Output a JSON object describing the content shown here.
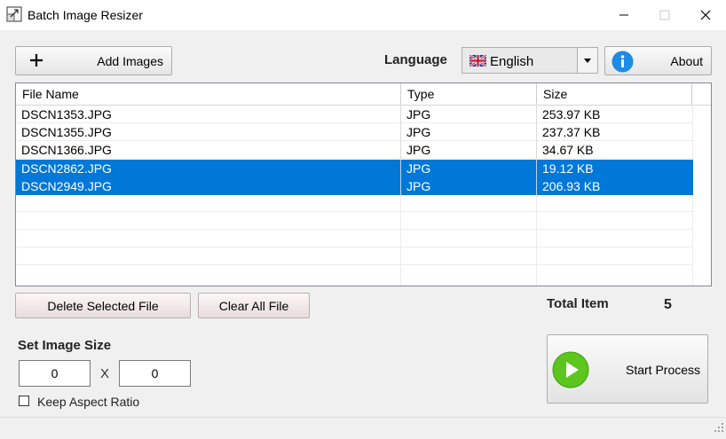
{
  "window": {
    "title": "Batch Image Resizer",
    "accent": "#0078d7"
  },
  "toolbar": {
    "add_images_label": "Add Images",
    "language_label": "Language",
    "language_value": "English",
    "about_label": "About"
  },
  "file_list": {
    "columns": [
      "File Name",
      "Type",
      "Size"
    ],
    "rows": [
      {
        "name": "DSCN1353.JPG",
        "type": "JPG",
        "size": "253.97 KB",
        "selected": false
      },
      {
        "name": "DSCN1355.JPG",
        "type": "JPG",
        "size": "237.37 KB",
        "selected": false
      },
      {
        "name": "DSCN1366.JPG",
        "type": "JPG",
        "size": "34.67 KB",
        "selected": false
      },
      {
        "name": "DSCN2862.JPG",
        "type": "JPG",
        "size": "19.12 KB",
        "selected": true
      },
      {
        "name": "DSCN2949.JPG",
        "type": "JPG",
        "size": "206.93 KB",
        "selected": true
      }
    ]
  },
  "actions": {
    "delete_selected_label": "Delete Selected File",
    "clear_all_label": "Clear All File",
    "total_item_label": "Total Item",
    "total_item_value": "5"
  },
  "image_size": {
    "label": "Set Image Size",
    "width": "0",
    "separator": "X",
    "height": "0",
    "keep_aspect_label": "Keep Aspect Ratio",
    "keep_aspect_checked": false
  },
  "start": {
    "label": "Start Process"
  },
  "icons": {
    "app": "app-resize-icon",
    "add": "plus-icon",
    "flag": "uk-flag-icon",
    "about": "info-icon",
    "start": "play-icon"
  }
}
